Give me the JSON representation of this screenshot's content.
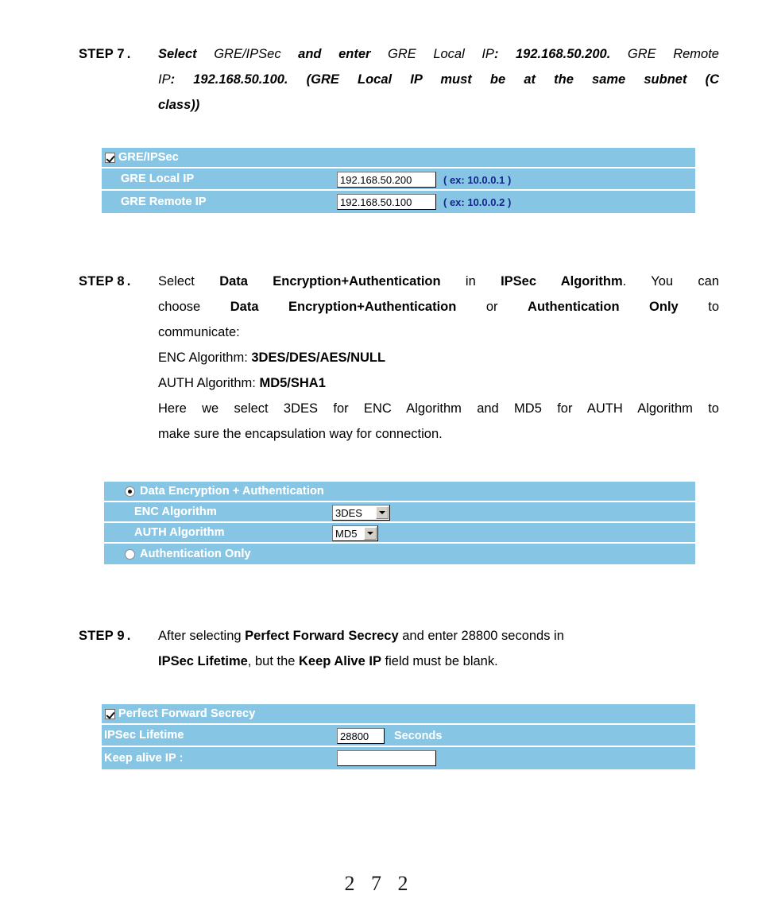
{
  "page": {
    "number": "2 7 2"
  },
  "steps": [
    {
      "label": "STEP 7",
      "dot": ".",
      "lines": [
        "Select GRE/IPSec and enter GRE Local IP: 192.168.50.200. GRE Remote",
        "IP: 192.168.50.100. (GRE Local IP must be at the same subnet (C",
        "class))"
      ]
    },
    {
      "label": "STEP 8",
      "dot": ".",
      "lines": [
        "Select Data Encryption+Authentication in IPSec Algorithm. You can",
        "choose Data Encryption+Authentication or Authentication Only to",
        "communicate:",
        "ENC Algorithm: 3DES/DES/AES/NULL",
        "AUTH Algorithm: MD5/SHA1",
        "Here we select 3DES for ENC Algorithm and MD5 for AUTH Algorithm to",
        "make sure the encapsulation way for connection."
      ]
    },
    {
      "label": "STEP 9",
      "dot": ".",
      "lines": [
        "After selecting Perfect Forward Secrecy and enter 28800 seconds in",
        "IPSec Lifetime, but the Keep Alive IP field must be blank."
      ]
    }
  ],
  "panel_gre": {
    "header": {
      "label": "GRE/IPSec",
      "checkbox_checked": true
    },
    "rows": [
      {
        "label": "GRE Local IP",
        "value": "192.168.50.200",
        "hint": "( ex: 10.0.0.1 )"
      },
      {
        "label": "GRE Remote IP",
        "value": "192.168.50.100",
        "hint": "( ex: 10.0.0.2 )"
      }
    ]
  },
  "panel_ipsec_algorithm": {
    "option_encrypt_auth": {
      "label": "Data Encryption + Authentication",
      "selected": true
    },
    "enc": {
      "label": "ENC Algorithm",
      "value": "3DES",
      "options": [
        "3DES",
        "DES",
        "AES",
        "NULL"
      ]
    },
    "auth": {
      "label": "AUTH Algorithm",
      "value": "MD5",
      "options": [
        "MD5",
        "SHA1"
      ]
    },
    "option_auth_only": {
      "label": "Authentication Only",
      "selected": false
    }
  },
  "panel_pfs": {
    "header": {
      "label": "Perfect Forward Secrecy",
      "checkbox_checked": true
    },
    "lifetime": {
      "label": "IPSec Lifetime",
      "value": "28800",
      "unit": "Seconds"
    },
    "keepalive": {
      "label": "Keep alive IP :",
      "value": "",
      "placeholder": ""
    }
  },
  "colors": {
    "panel_bg": "#86c5e3",
    "panel_label": "#ffffff",
    "hint_text": "#14268c"
  }
}
